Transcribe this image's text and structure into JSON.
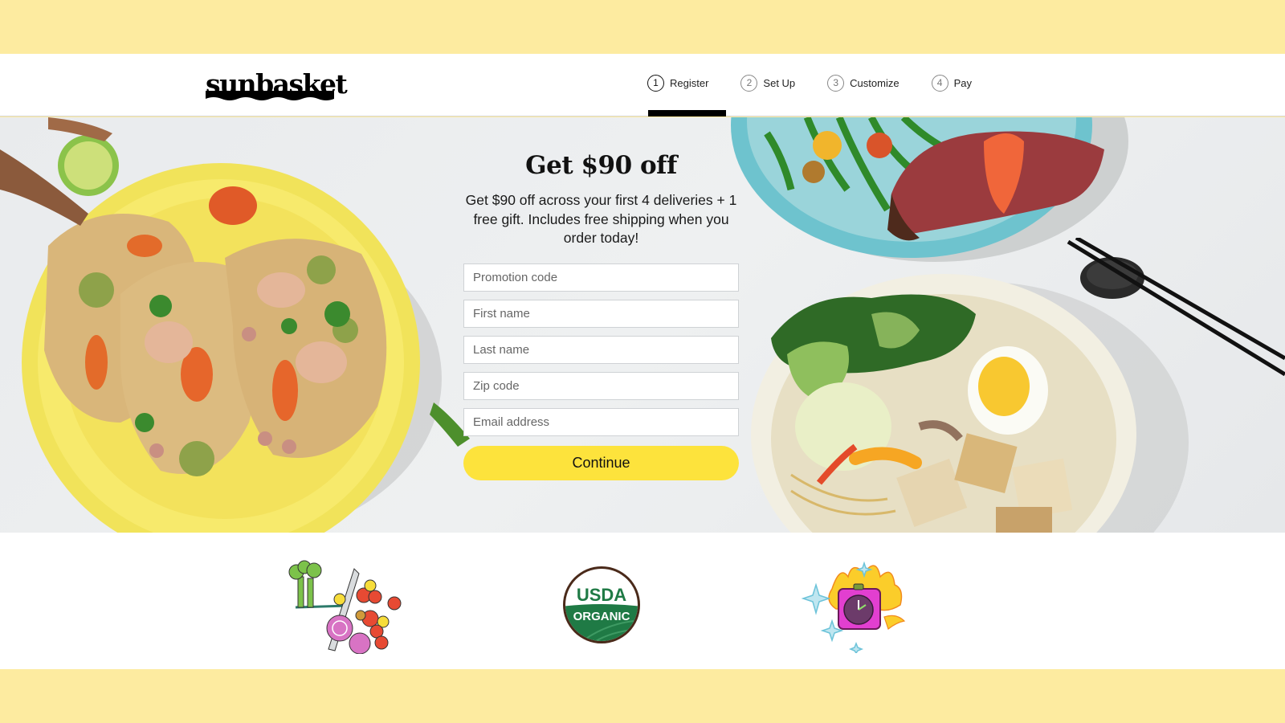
{
  "brand": {
    "name": "sunbasket"
  },
  "steps": [
    {
      "number": "1",
      "label": "Register",
      "active": true
    },
    {
      "number": "2",
      "label": "Set Up",
      "active": false
    },
    {
      "number": "3",
      "label": "Customize",
      "active": false
    },
    {
      "number": "4",
      "label": "Pay",
      "active": false
    }
  ],
  "hero": {
    "title": "Get $90 off",
    "subtitle": "Get $90 off across your first 4 deliveries + 1 free gift. Includes free shipping when you order today!",
    "fields": [
      {
        "name": "promotion-code",
        "placeholder": "Promotion code",
        "value": ""
      },
      {
        "name": "first-name",
        "placeholder": "First name",
        "value": ""
      },
      {
        "name": "last-name",
        "placeholder": "Last name",
        "value": ""
      },
      {
        "name": "zip-code",
        "placeholder": "Zip code",
        "value": ""
      },
      {
        "name": "email-address",
        "placeholder": "Email address",
        "value": ""
      }
    ],
    "continue_label": "Continue",
    "images": [
      "shrimp-tacos-plate",
      "steak-green-beans-plate",
      "tofu-ramen-bowl",
      "chopsticks"
    ]
  },
  "features": {
    "badges": [
      {
        "icon": "vegetables-illustration-icon"
      },
      {
        "icon": "usda-organic-icon",
        "line1": "USDA",
        "line2": "ORGANIC"
      },
      {
        "icon": "fast-clock-illustration-icon"
      }
    ]
  },
  "colors": {
    "band_yellow": "#fdeba0",
    "button_yellow": "#fde33c",
    "usda_green": "#1f7a45",
    "usda_brown": "#4a2a1a"
  }
}
